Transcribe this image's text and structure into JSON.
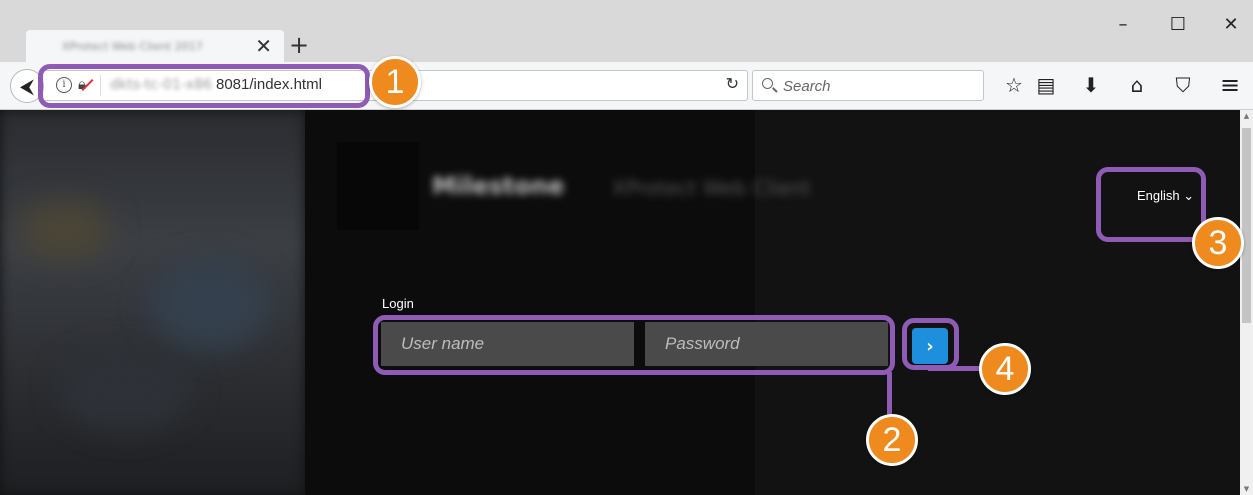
{
  "browser": {
    "tab_title": "XProtect Web Client 2017",
    "tab_close": "✕",
    "new_tab": "+",
    "window_controls": {
      "minimize": "–",
      "maximize": "☐",
      "close": "✕"
    },
    "url_host": "dkts-tc-01-x86",
    "url_path": "8081/index.html",
    "search_placeholder": "Search",
    "back_glyph": "⮜",
    "reload_glyph": "↻",
    "toolbar_glyphs": {
      "bookmark": "☆",
      "reading_list": "▤",
      "downloads": "⬇",
      "home": "⌂",
      "pocket": "⛉",
      "menu": "≡"
    }
  },
  "page": {
    "brand_name": "Milestone",
    "brand_subtitle": "XProtect Web Client",
    "language_label": "English",
    "language_caret": "⌄",
    "login_label": "Login",
    "username_placeholder": "User name",
    "password_placeholder": "Password",
    "submit_glyph": "›"
  },
  "annotations": {
    "badges": [
      "1",
      "2",
      "3",
      "4"
    ],
    "color": "#8e5bb5",
    "badge_color": "#ef8a1e"
  },
  "icons": [
    "back-icon",
    "info-icon",
    "insecure-lock-icon",
    "reload-icon",
    "search-icon",
    "bookmark-star-icon",
    "reading-list-icon",
    "download-icon",
    "home-icon",
    "pocket-icon",
    "menu-icon",
    "chevron-down-icon",
    "arrow-right-icon"
  ]
}
